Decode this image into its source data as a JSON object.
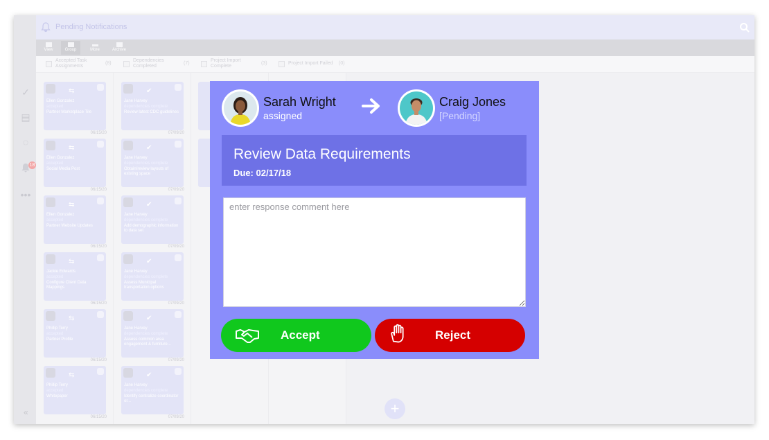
{
  "header": {
    "title": "Pending Notifications"
  },
  "toolbar": {
    "items": [
      {
        "label": "View",
        "icon": "view-icon"
      },
      {
        "label": "Group",
        "icon": "tag-icon"
      },
      {
        "label": "More",
        "icon": "more-icon"
      },
      {
        "label": "Archive",
        "icon": "archive-icon"
      }
    ]
  },
  "rail": {
    "notification_count": "18"
  },
  "columns": [
    {
      "title_line1": "Accepted Task",
      "title_line2": "Assignments",
      "count": "(8)"
    },
    {
      "title_line1": "Dependencies",
      "title_line2": "Completed",
      "count": "(7)"
    },
    {
      "title_line1": "Project Import",
      "title_line2": "Complete",
      "count": "(3)"
    },
    {
      "title_line1": "Project Import Failed",
      "title_line2": "",
      "count": "(0)"
    }
  ],
  "col1_cards": [
    {
      "person": "Ellen Gonzalez",
      "status": "accepted",
      "task": "Partner Marketplace Tile",
      "date": "06/15/20"
    },
    {
      "person": "Ellen Gonzalez",
      "status": "accepted",
      "task": "Social Media Post",
      "date": "06/15/20"
    },
    {
      "person": "Ellen Gonzalez",
      "status": "accepted",
      "task": "Partner Website Updates",
      "date": "06/15/20"
    },
    {
      "person": "Jackie Edwards",
      "status": "accepted",
      "task": "Configure Client Data Mappings",
      "date": "06/15/20"
    },
    {
      "person": "Phillip Terry",
      "status": "accepted",
      "task": "Partner Profile",
      "date": "06/15/20"
    },
    {
      "person": "Phillip Terry",
      "status": "accepted",
      "task": "Whitepaper",
      "date": "06/15/20"
    }
  ],
  "col2_cards": [
    {
      "person": "Jane Harvey",
      "status": "dependencies complete",
      "task": "Review latest CDC guidelines",
      "date": "07/09/20"
    },
    {
      "person": "Jane Harvey",
      "status": "dependencies complete",
      "task": "Obtain/review layouts of existing space",
      "date": "07/09/20"
    },
    {
      "person": "Jane Harvey",
      "status": "dependencies complete",
      "task": "Add demographic information to data set",
      "date": "07/09/20"
    },
    {
      "person": "Jane Harvey",
      "status": "dependencies complete",
      "task": "Assess Municipal transportation options",
      "date": "07/09/20"
    },
    {
      "person": "Jane Harvey",
      "status": "dependencies complete",
      "task": "Assess common area engagement & furniture...",
      "date": "07/09/20"
    },
    {
      "person": "Jane Harvey",
      "status": "dependencies complete",
      "task": "Identify centralize coordinator or...",
      "date": "07/09/20"
    }
  ],
  "modal": {
    "assigner": {
      "name": "Sarah Wright",
      "role": "assigned"
    },
    "assignee": {
      "name": "Craig Jones",
      "status": "[Pending]"
    },
    "task": {
      "title": "Review Data Requirements",
      "due": "Due: 02/17/18"
    },
    "comment_placeholder": "enter response comment here",
    "accept_label": "Accept",
    "reject_label": "Reject"
  },
  "colors": {
    "modal_bg": "#8a8dfb",
    "task_bg": "#6e71e6",
    "accept": "#10c81d",
    "reject": "#d50000"
  }
}
